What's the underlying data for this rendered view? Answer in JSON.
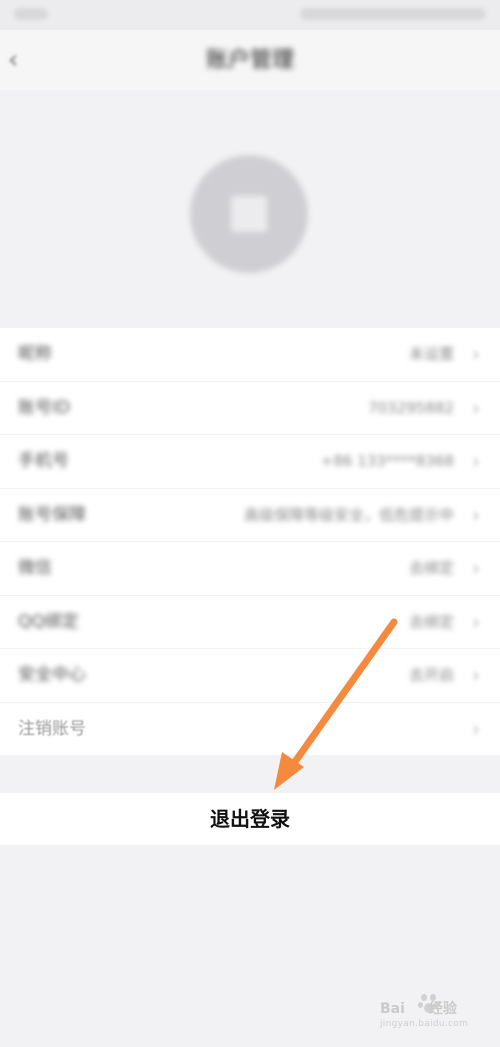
{
  "header": {
    "back_icon": "chevron-left-icon",
    "title": "账户管理"
  },
  "avatar": {
    "icon": "avatar-placeholder-icon"
  },
  "settings_list": {
    "items": [
      {
        "label": "昵称",
        "value": "未设置"
      },
      {
        "label": "账号ID",
        "value": "703295882"
      },
      {
        "label": "手机号",
        "value": "+86 133****8368"
      },
      {
        "label": "账号保障",
        "value": "高级保障等级安全，低危提示中"
      },
      {
        "label": "微信",
        "value": "去绑定"
      },
      {
        "label": "QQ绑定",
        "value": "去绑定"
      },
      {
        "label": "安全中心",
        "value": "去开启"
      },
      {
        "label": "注销账号",
        "value": ""
      }
    ],
    "chevron_icon": "chevron-right-icon"
  },
  "logout": {
    "label": "退出登录"
  },
  "annotation": {
    "arrow_color": "#f5893d"
  },
  "watermark": {
    "brand": "Bai",
    "brand_suffix": "经验",
    "domain": "jingyan.baidu.com"
  },
  "colors": {
    "background": "#f2f2f4",
    "row_background": "#ffffff",
    "logout_text": "#111111"
  }
}
